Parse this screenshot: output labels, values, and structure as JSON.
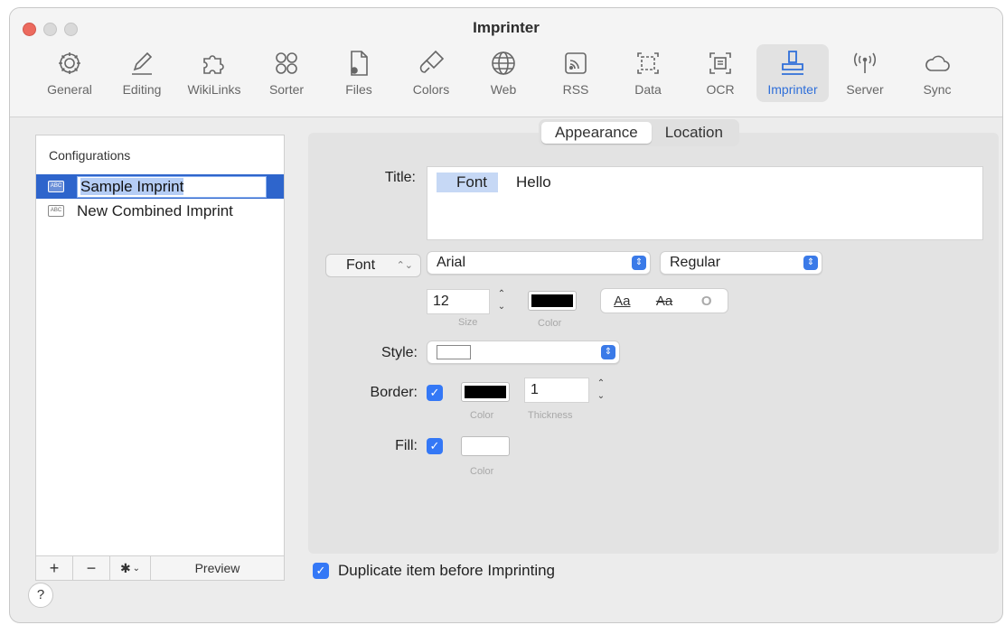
{
  "app": {
    "title": "Imprinter"
  },
  "toolbar": {
    "items": [
      {
        "label": "General",
        "icon": "gear-icon"
      },
      {
        "label": "Editing",
        "icon": "pencil-icon"
      },
      {
        "label": "WikiLinks",
        "icon": "puzzle-icon"
      },
      {
        "label": "Sorter",
        "icon": "four-circles-icon"
      },
      {
        "label": "Files",
        "icon": "file-gear-icon"
      },
      {
        "label": "Colors",
        "icon": "brush-icon"
      },
      {
        "label": "Web",
        "icon": "globe-icon"
      },
      {
        "label": "RSS",
        "icon": "rss-icon"
      },
      {
        "label": "Data",
        "icon": "dashed-frame-icon"
      },
      {
        "label": "OCR",
        "icon": "scan-icon"
      },
      {
        "label": "Imprinter",
        "icon": "stamp-icon",
        "active": true
      },
      {
        "label": "Server",
        "icon": "antenna-icon"
      },
      {
        "label": "Sync",
        "icon": "cloud-icon"
      }
    ]
  },
  "configurations": {
    "header": "Configurations",
    "items": [
      {
        "label": "Sample Imprint",
        "selected": true,
        "icon_text": "ABC"
      },
      {
        "label": "New Combined Imprint",
        "selected": false,
        "icon_text": "ABC"
      }
    ],
    "footer": {
      "add": "+",
      "remove": "−",
      "gear": "✱",
      "gear_chevron": "⌄",
      "preview": "Preview"
    }
  },
  "tabs": {
    "appearance": "Appearance",
    "location": "Location"
  },
  "form": {
    "title_label": "Title:",
    "title_token": "Font",
    "title_text": "Hello",
    "font_button": "Font",
    "font_family": "Arial",
    "font_style": "Regular",
    "size_value": "12",
    "size_caption": "Size",
    "color_caption": "Color",
    "aa_underline": "Aa",
    "aa_strike": "Aa",
    "aa_outline": "O",
    "style_label": "Style:",
    "border_label": "Border:",
    "border_color_caption": "Color",
    "thickness_value": "1",
    "thickness_caption": "Thickness",
    "fill_label": "Fill:",
    "fill_color_caption": "Color"
  },
  "duplicate": {
    "label": "Duplicate item before Imprinting",
    "checked": true
  },
  "help": {
    "label": "?"
  },
  "colors": {
    "accent": "#3478f6",
    "selection": "#2e65cc",
    "font_color": "#000000",
    "border_color": "#000000",
    "fill_color": "#ffffff"
  }
}
